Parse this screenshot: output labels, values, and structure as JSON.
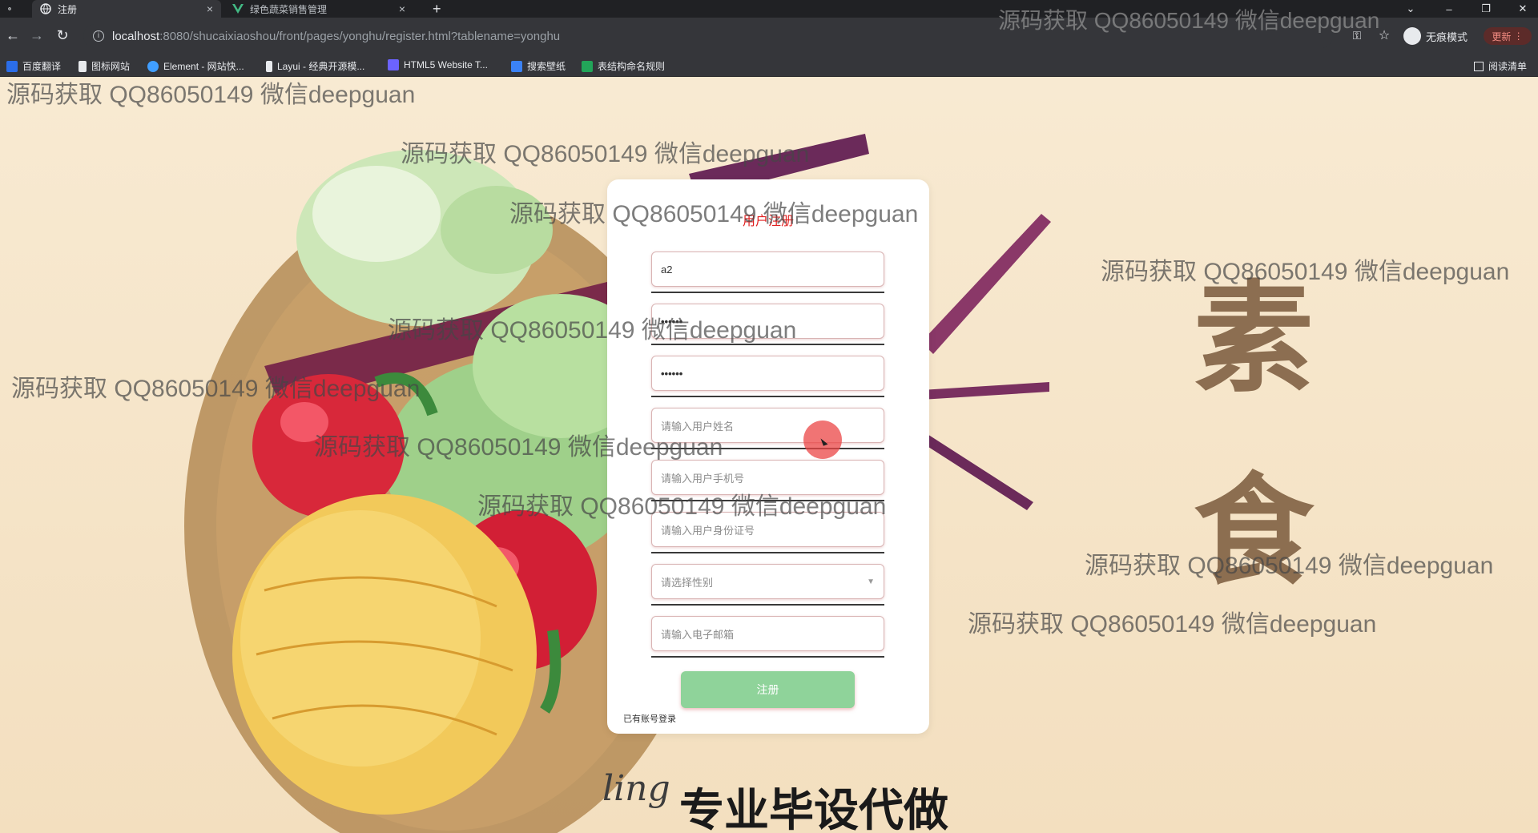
{
  "browser": {
    "tabs": [
      {
        "title": "注册",
        "close": "×"
      },
      {
        "title": "绿色蔬菜销售管理",
        "close": "×"
      }
    ],
    "new_tab": "+",
    "window_controls": {
      "dropdown": "⌄",
      "minimize": "–",
      "restore": "❐",
      "close": "✕"
    },
    "url_host": "localhost",
    "url_rest": ":8080/shucaixiaoshou/front/pages/yonghu/register.html?tablename=yonghu",
    "incognito_label": "无痕模式",
    "update_label": "更新",
    "bookmarks": [
      "百度翻译",
      "图标网站",
      "Element - 网站快...",
      "Layui - 经典开源模...",
      "HTML5 Website T...",
      "搜索壁纸",
      "表结构命名规则"
    ],
    "reading_list": "阅读清单"
  },
  "form": {
    "title": "用户注册",
    "fields": [
      {
        "value": "a2",
        "kind": "value"
      },
      {
        "value": "••••••",
        "kind": "value"
      },
      {
        "value": "••••••",
        "kind": "value"
      },
      {
        "value": "请输入用户姓名",
        "kind": "placeholder"
      },
      {
        "value": "请输入用户手机号",
        "kind": "placeholder"
      },
      {
        "value": "请输入用户身份证号",
        "kind": "placeholder"
      },
      {
        "value": "请选择性别",
        "kind": "select"
      },
      {
        "value": "请输入电子邮箱",
        "kind": "placeholder"
      }
    ],
    "submit_label": "注册",
    "login_link": "已有账号登录"
  },
  "decor": {
    "side_chars": [
      "素",
      "食"
    ],
    "banner": "专业毕设代做",
    "signature": "ling"
  },
  "watermark_text": "源码获取 QQ86050149 微信deepguan",
  "colors": {
    "accent_title": "#e02020",
    "submit_bg": "#8fd39a",
    "page_bg": "#f6e6cb"
  }
}
